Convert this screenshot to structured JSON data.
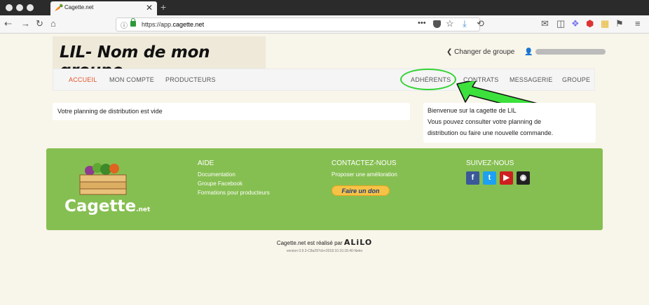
{
  "browser": {
    "tab_title": "Cagette.net",
    "tab_close": "✕",
    "new_tab": "+",
    "url_prefix": "https://app.",
    "url_domain": "cagette.net",
    "more": "•••"
  },
  "header": {
    "group_name": "LIL- Nom de mon groupe",
    "change_group": "❮ Changer de groupe",
    "user_icon": "👤"
  },
  "nav": {
    "items": [
      {
        "label": "ACCUEIL",
        "active": true
      },
      {
        "label": "MON COMPTE"
      },
      {
        "label": "PRODUCTEURS"
      },
      {
        "label": "ADHÉRENTS"
      },
      {
        "label": "CONTRATS"
      },
      {
        "label": "MESSAGERIE"
      },
      {
        "label": "GROUPE"
      }
    ]
  },
  "main": {
    "planning_empty": "Votre planning de distribution est vide",
    "welcome_lines": [
      "Bienvenue sur la cagette de LIL",
      "Vous pouvez consulter votre planning de",
      "distribution ou faire une nouvelle commande."
    ]
  },
  "footer": {
    "logo_text": "Cagette",
    "logo_suffix": ".net",
    "help": {
      "title": "AIDE",
      "links": [
        "Documentation",
        "Groupe Facebook",
        "Formations pour producteurs"
      ]
    },
    "contact": {
      "title": "CONTACTEZ-NOUS",
      "link": "Proposer une amélioration",
      "donate": "Faire un don"
    },
    "follow": {
      "title": "SUIVEZ-NOUS",
      "icons": [
        {
          "name": "facebook-icon",
          "glyph": "f",
          "color": "#3b5998"
        },
        {
          "name": "twitter-icon",
          "glyph": "t",
          "color": "#1da1f2"
        },
        {
          "name": "youtube-icon",
          "glyph": "▶",
          "color": "#cd201f"
        },
        {
          "name": "github-icon",
          "glyph": "◉",
          "color": "#222222"
        }
      ]
    }
  },
  "credit": {
    "text": "Cagette.net est réalisé par",
    "company": "ALiLO",
    "version": "version 0.9.2-C8a297cb+2018.10.10.18.40-Neko"
  },
  "colors": {
    "footer": "#86bf51",
    "active_nav": "#e2532a",
    "highlight": "#32d232"
  }
}
